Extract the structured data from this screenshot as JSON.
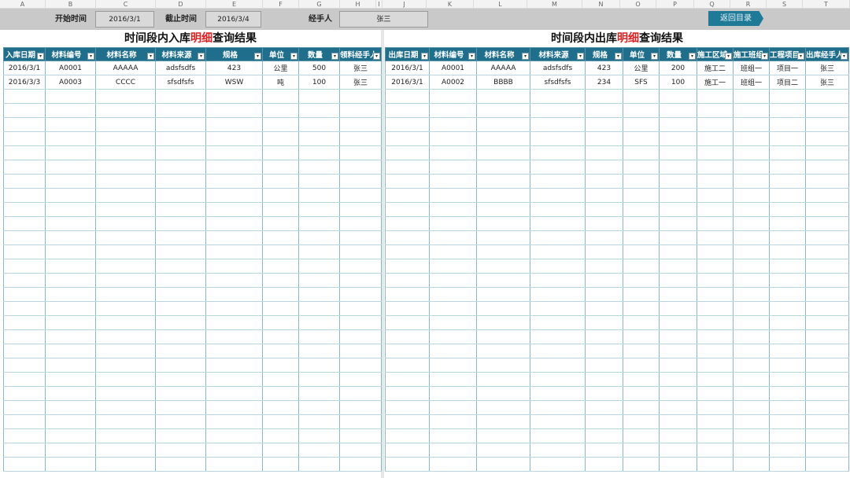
{
  "column_letters": [
    "A",
    "B",
    "C",
    "D",
    "E",
    "F",
    "G",
    "H",
    "I",
    "J",
    "K",
    "L",
    "M",
    "N",
    "O",
    "P",
    "Q",
    "R",
    "S",
    "T"
  ],
  "toolbar": {
    "start_label": "开始时间",
    "start_value": "2016/3/1",
    "end_label": "截止时间",
    "end_value": "2016/3/4",
    "handler_label": "经手人",
    "handler_value": "张三",
    "back_button": "返回目录"
  },
  "inbound": {
    "title_prefix": "时间段内入库",
    "title_highlight": "明细",
    "title_suffix": "查询结果",
    "headers": [
      "入库日期",
      "材料编号",
      "材料名称",
      "材料来源",
      "规格",
      "单位",
      "数量",
      "领料经手人"
    ],
    "rows": [
      [
        "2016/3/1",
        "A0001",
        "AAAAA",
        "adsfsdfs",
        "423",
        "公里",
        "500",
        "张三"
      ],
      [
        "2016/3/3",
        "A0003",
        "CCCC",
        "sfsdfsfs",
        "WSW",
        "吨",
        "100",
        "张三"
      ]
    ]
  },
  "outbound": {
    "title_prefix": "时间段内出库",
    "title_highlight": "明细",
    "title_suffix": "查询结果",
    "headers": [
      "出库日期",
      "材料编号",
      "材料名称",
      "材料来源",
      "规格",
      "单位",
      "数量",
      "施工区域",
      "施工班组",
      "工程项目",
      "出库经手人"
    ],
    "rows": [
      [
        "2016/3/1",
        "A0001",
        "AAAAA",
        "adsfsdfs",
        "423",
        "公里",
        "200",
        "施工二",
        "班组一",
        "项目一",
        "张三"
      ],
      [
        "2016/3/1",
        "A0002",
        "BBBB",
        "sfsdfsfs",
        "234",
        "SFS",
        "100",
        "施工一",
        "班组一",
        "项目二",
        "张三"
      ]
    ]
  },
  "colors": {
    "header_bg": "#1e6e8c",
    "highlight": "#e02020",
    "button_bg": "#1f7a98"
  }
}
